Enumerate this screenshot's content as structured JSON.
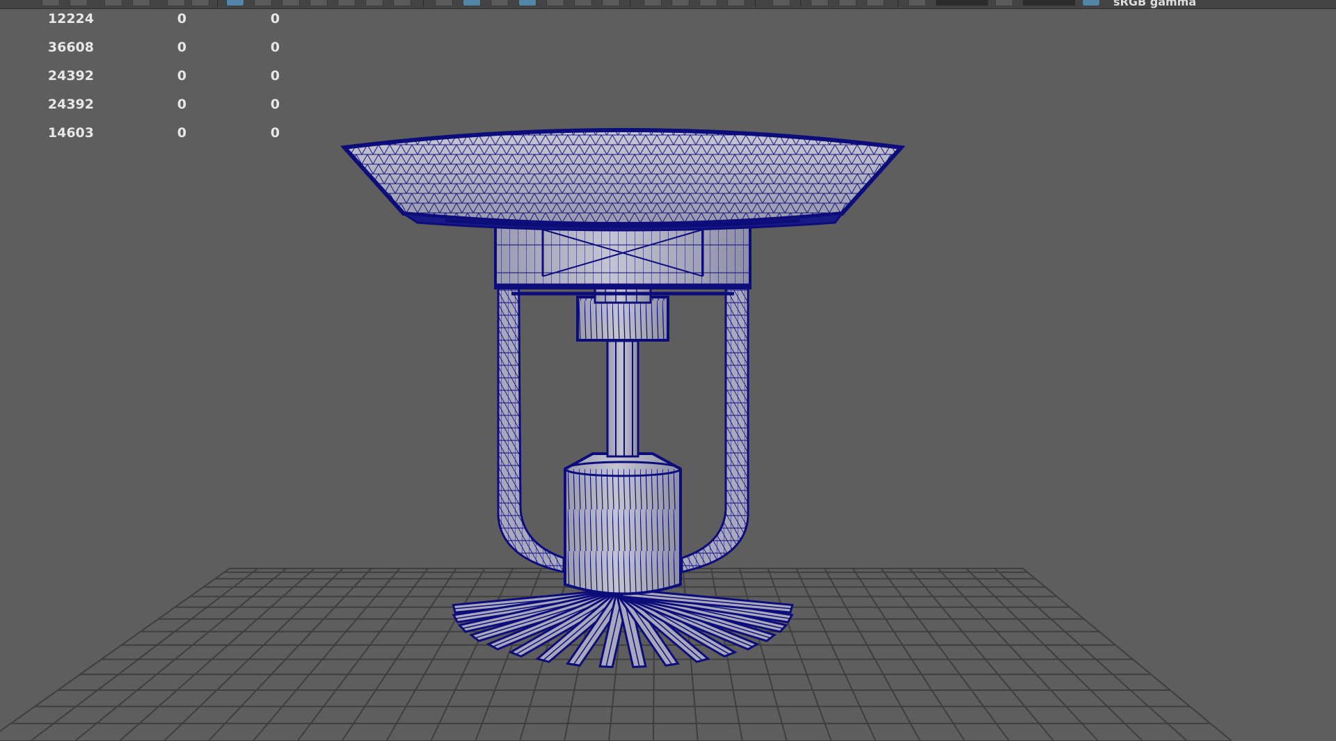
{
  "toolbar": {
    "shading_label": "sRGB gamma",
    "accent": "#5285a6"
  },
  "hud": {
    "rows": [
      {
        "value": "12224",
        "col2": "0",
        "col3": "0"
      },
      {
        "value": "36608",
        "col2": "0",
        "col3": "0"
      },
      {
        "value": "24392",
        "col2": "0",
        "col3": "0"
      },
      {
        "value": "24392",
        "col2": "0",
        "col3": "0"
      },
      {
        "value": "14603",
        "col2": "0",
        "col3": "0"
      }
    ]
  },
  "viewport": {
    "background": "#5e5e5e",
    "wire_color": "#0c0c7a",
    "surface_color": "#b4b4c2",
    "grid_color": "#3a3a3a",
    "object": "sprinkler-head-model"
  }
}
